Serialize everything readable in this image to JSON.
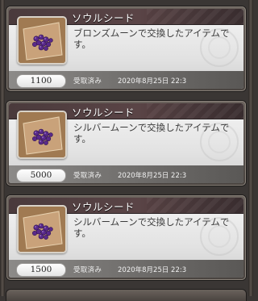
{
  "items": [
    {
      "name": "ソウルシード",
      "description": "ブロンズムーンで交換したアイテムです。",
      "quantity": "1100",
      "status": "受取済み",
      "date": "2020年8月25日 22:3"
    },
    {
      "name": "ソウルシード",
      "description": "シルバームーンで交換したアイテムです。",
      "quantity": "5000",
      "status": "受取済み",
      "date": "2020年8月25日 22:3"
    },
    {
      "name": "ソウルシード",
      "description": "シルバームーンで交換したアイテムです。",
      "quantity": "1500",
      "status": "受取済み",
      "date": "2020年8月25日 22:3"
    }
  ],
  "icons": {
    "item": "soul-seed-icon",
    "ornament": "ornament-icon"
  },
  "colors": {
    "name_bar": "#4a3a3c",
    "card_body": "#eeeeee",
    "bottom_bar": "#7a7876",
    "seed_purple": "#5a2a8a"
  }
}
